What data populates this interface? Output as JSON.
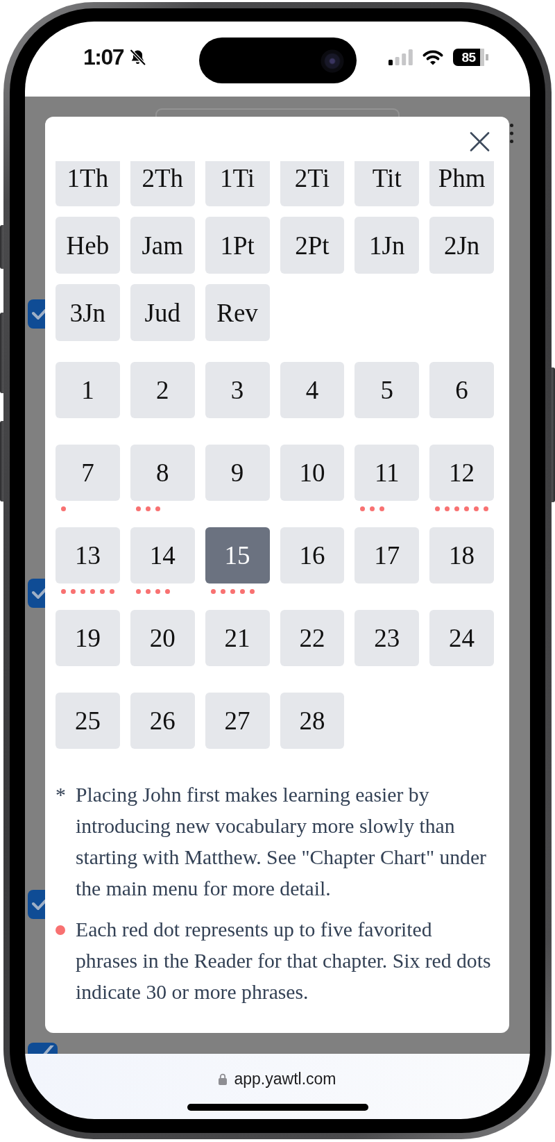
{
  "status_bar": {
    "time": "1:07",
    "battery": "85"
  },
  "background": {
    "checkboxes": [
      {
        "checked": true
      },
      {
        "checked": true
      },
      {
        "checked": true
      },
      {
        "checked": true
      }
    ]
  },
  "modal": {
    "books": [
      {
        "label": "1Th",
        "selected": false
      },
      {
        "label": "2Th",
        "selected": false
      },
      {
        "label": "1Ti",
        "selected": false
      },
      {
        "label": "2Ti",
        "selected": false
      },
      {
        "label": "Tit",
        "selected": false
      },
      {
        "label": "Phm",
        "selected": false
      },
      {
        "label": "Heb",
        "selected": false
      },
      {
        "label": "Jam",
        "selected": false
      },
      {
        "label": "1Pt",
        "selected": false
      },
      {
        "label": "2Pt",
        "selected": false
      },
      {
        "label": "1Jn",
        "selected": false
      },
      {
        "label": "2Jn",
        "selected": false
      },
      {
        "label": "3Jn",
        "selected": false
      },
      {
        "label": "Jud",
        "selected": false
      },
      {
        "label": "Rev",
        "selected": false
      }
    ],
    "chapters": [
      {
        "label": "1",
        "selected": false
      },
      {
        "label": "2",
        "selected": false
      },
      {
        "label": "3",
        "selected": false
      },
      {
        "label": "4",
        "selected": false
      },
      {
        "label": "5",
        "selected": false
      },
      {
        "label": "6",
        "selected": false
      },
      {
        "label": "7",
        "selected": false,
        "dots": [
          {
            "color": "#f87171"
          }
        ]
      },
      {
        "label": "8",
        "selected": false,
        "dots": [
          {
            "color": "#f87171"
          },
          {
            "color": "#f87171"
          },
          {
            "color": "#f87171"
          }
        ]
      },
      {
        "label": "9",
        "selected": false
      },
      {
        "label": "10",
        "selected": false
      },
      {
        "label": "11",
        "selected": false,
        "dots": [
          {
            "color": "#f87171"
          },
          {
            "color": "#f87171"
          },
          {
            "color": "#f87171"
          }
        ]
      },
      {
        "label": "12",
        "selected": false,
        "dots": [
          {
            "color": "#f87171"
          },
          {
            "color": "#f87171"
          },
          {
            "color": "#f87171"
          },
          {
            "color": "#f87171"
          },
          {
            "color": "#f87171"
          },
          {
            "color": "#f87171"
          }
        ]
      },
      {
        "label": "13",
        "selected": false,
        "dots": [
          {
            "color": "#f87171"
          },
          {
            "color": "#f87171"
          },
          {
            "color": "#f87171"
          },
          {
            "color": "#f87171"
          },
          {
            "color": "#f87171"
          },
          {
            "color": "#f87171"
          }
        ]
      },
      {
        "label": "14",
        "selected": false,
        "dots": [
          {
            "color": "#f87171"
          },
          {
            "color": "#f87171"
          },
          {
            "color": "#f87171"
          },
          {
            "color": "#f87171"
          }
        ]
      },
      {
        "label": "15",
        "selected": true,
        "dots": [
          {
            "color": "#f87171"
          },
          {
            "color": "#f87171"
          },
          {
            "color": "#f87171"
          },
          {
            "color": "#f87171"
          },
          {
            "color": "#f87171"
          }
        ]
      },
      {
        "label": "16",
        "selected": false
      },
      {
        "label": "17",
        "selected": false
      },
      {
        "label": "18",
        "selected": false
      },
      {
        "label": "19",
        "selected": false
      },
      {
        "label": "20",
        "selected": false
      },
      {
        "label": "21",
        "selected": false
      },
      {
        "label": "22",
        "selected": false
      },
      {
        "label": "23",
        "selected": false
      },
      {
        "label": "24",
        "selected": false
      },
      {
        "label": "25",
        "selected": false
      },
      {
        "label": "26",
        "selected": false
      },
      {
        "label": "27",
        "selected": false
      },
      {
        "label": "28",
        "selected": false
      }
    ],
    "notes": [
      {
        "kind": "asterisk",
        "marker": "*",
        "text": "Placing John first makes learning easier by introducing new vocabulary more slowly than starting with Matthew. See \"Chapter Chart\" under the main menu for more detail."
      },
      {
        "kind": "dot",
        "text": "Each red dot represents up to five favorited phrases in the Reader for that chapter. Six red dots indicate 30 or more phrases."
      }
    ]
  },
  "browser": {
    "url": "app.yawtl.com"
  }
}
